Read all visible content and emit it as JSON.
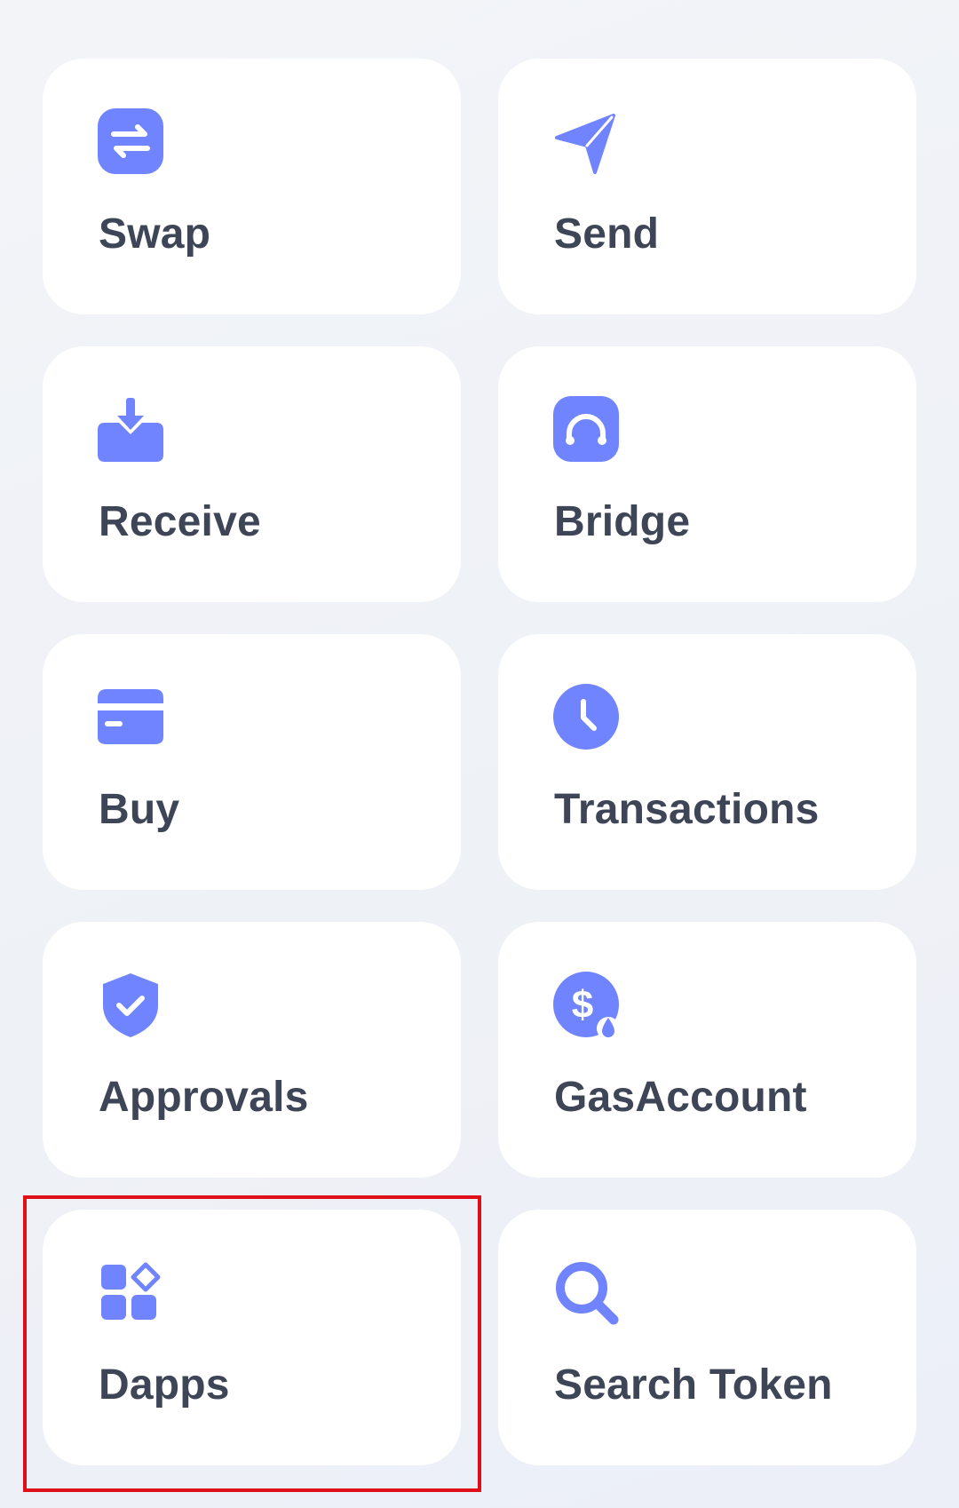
{
  "colors": {
    "accent": "#7084ff",
    "label": "#3e4557",
    "tile_background": "#ffffff",
    "highlight_border": "#e0101b"
  },
  "actions": [
    {
      "label": "Swap",
      "icon": "swap-icon"
    },
    {
      "label": "Send",
      "icon": "send-icon"
    },
    {
      "label": "Receive",
      "icon": "receive-icon"
    },
    {
      "label": "Bridge",
      "icon": "bridge-icon"
    },
    {
      "label": "Buy",
      "icon": "credit-card-icon"
    },
    {
      "label": "Transactions",
      "icon": "clock-icon"
    },
    {
      "label": "Approvals",
      "icon": "shield-check-icon"
    },
    {
      "label": "GasAccount",
      "icon": "gas-dollar-icon"
    },
    {
      "label": "Dapps",
      "icon": "apps-grid-icon"
    },
    {
      "label": "Search Token",
      "icon": "search-icon"
    }
  ],
  "highlighted_action": "Dapps"
}
